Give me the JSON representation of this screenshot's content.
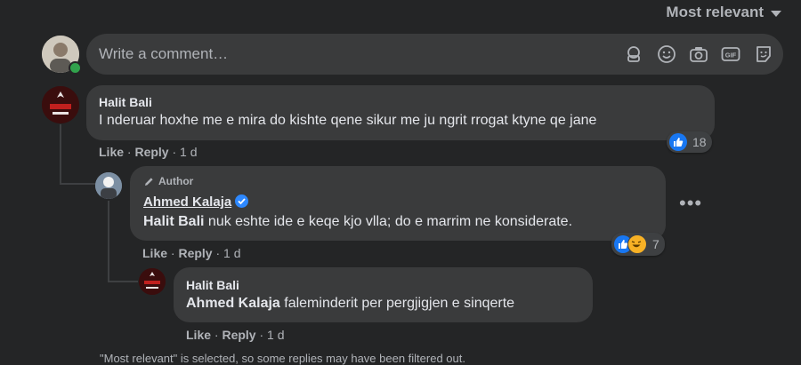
{
  "sort": {
    "label": "Most relevant"
  },
  "composer": {
    "placeholder": "Write a comment…"
  },
  "comments": [
    {
      "author": "Halit Bali",
      "text": "I nderuar hoxhe me e mira do kishte qene sikur me ju ngrit rrogat ktyne qe jane",
      "actions": {
        "like": "Like",
        "reply": "Reply",
        "time": "1 d"
      },
      "reaction_count": "18"
    },
    {
      "badge": "Author",
      "author": "Ahmed Kalaja",
      "mention": "Halit Bali",
      "text": " nuk eshte ide e keqe kjo vlla; do e marrim ne konsiderate.",
      "actions": {
        "like": "Like",
        "reply": "Reply",
        "time": "1 d"
      },
      "reaction_count": "7",
      "more": "•••"
    },
    {
      "author": "Halit Bali",
      "mention": "Ahmed Kalaja",
      "text": " faleminderit per pergjigjen e sinqerte",
      "actions": {
        "like": "Like",
        "reply": "Reply",
        "time": "1 d"
      }
    }
  ],
  "footer": "\"Most relevant\" is selected, so some replies may have been filtered out.",
  "colors": {
    "bg": "#242526",
    "bubble": "#3a3b3c",
    "accent": "#1877f2",
    "muted": "#b0b3b8"
  }
}
